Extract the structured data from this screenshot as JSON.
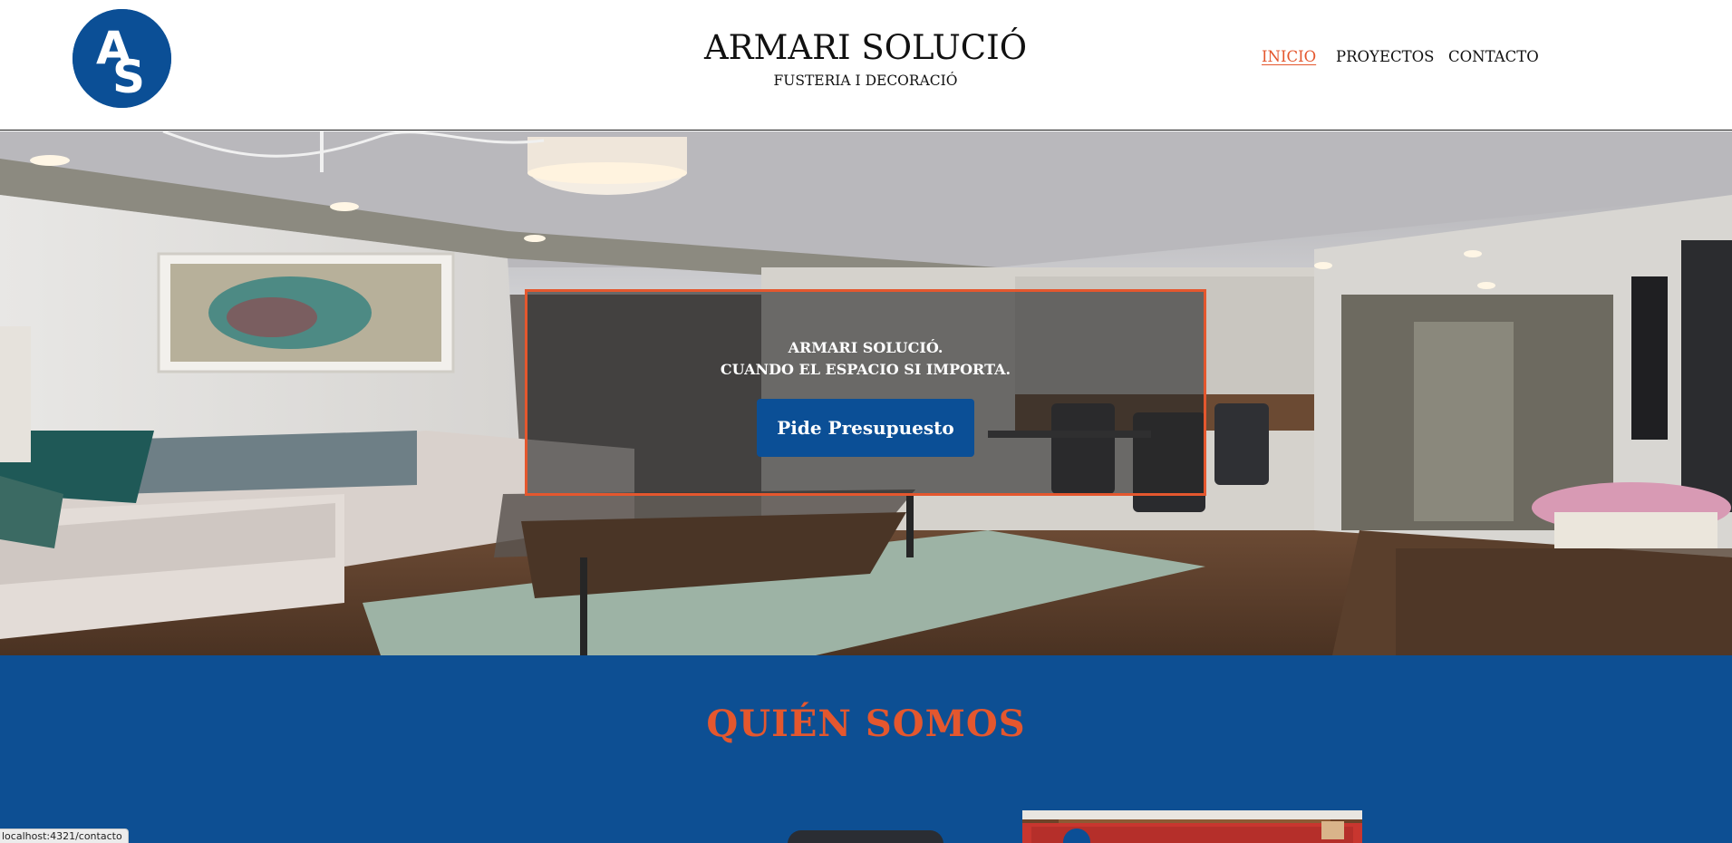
{
  "header": {
    "logo_letters": "AS",
    "title": "ARMARI SOLUCIÓ",
    "subtitle": "FUSTERIA I DECORACIÓ"
  },
  "nav": {
    "items": [
      {
        "label": "INICIO",
        "active": true
      },
      {
        "label": "PROYECTOS",
        "active": false
      },
      {
        "label": "CONTACTO",
        "active": false
      }
    ]
  },
  "hero": {
    "line1": "ARMARI SOLUCIÓ.",
    "line2": "CUANDO EL ESPACIO SI IMPORTA.",
    "cta_label": "Pide Presupuesto"
  },
  "about": {
    "title": "QUIÉN SOMOS"
  },
  "status_bar": {
    "url": "localhost:4321/contacto"
  },
  "colors": {
    "brand_blue": "#0b4f96",
    "accent_orange": "#e4572e",
    "section_blue": "#0d4f93"
  }
}
